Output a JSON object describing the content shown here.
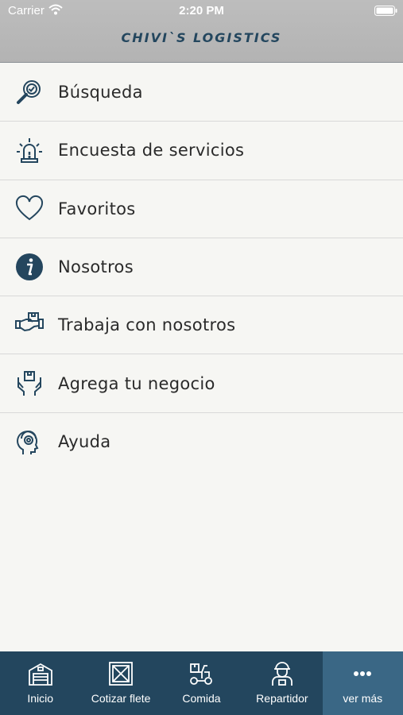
{
  "status_bar": {
    "carrier": "Carrier",
    "time": "2:20 PM"
  },
  "header": {
    "title": "CHIVI`S LOGISTICS"
  },
  "menu": {
    "items": [
      {
        "label": "Búsqueda",
        "icon": "search-magnifier-icon"
      },
      {
        "label": "Encuesta de servicios",
        "icon": "alarm-beacon-icon"
      },
      {
        "label": "Favoritos",
        "icon": "heart-icon"
      },
      {
        "label": "Nosotros",
        "icon": "info-icon"
      },
      {
        "label": "Trabaja con nosotros",
        "icon": "handshake-package-icon"
      },
      {
        "label": "Agrega tu negocio",
        "icon": "hands-box-icon"
      },
      {
        "label": "Ayuda",
        "icon": "headset-support-icon"
      }
    ]
  },
  "tabbar": {
    "tabs": [
      {
        "label": "Inicio",
        "icon": "warehouse-icon"
      },
      {
        "label": "Cotizar flete",
        "icon": "crate-icon"
      },
      {
        "label": "Comida",
        "icon": "scooter-icon"
      },
      {
        "label": "Repartidor",
        "icon": "courier-icon"
      },
      {
        "label": "ver más",
        "icon": "more-dots-icon",
        "active": true
      }
    ]
  },
  "colors": {
    "tabbar_bg": "#23465e",
    "tab_active_bg": "#3a6785",
    "title": "#23465e",
    "header_bg": "#b7b7b7"
  }
}
